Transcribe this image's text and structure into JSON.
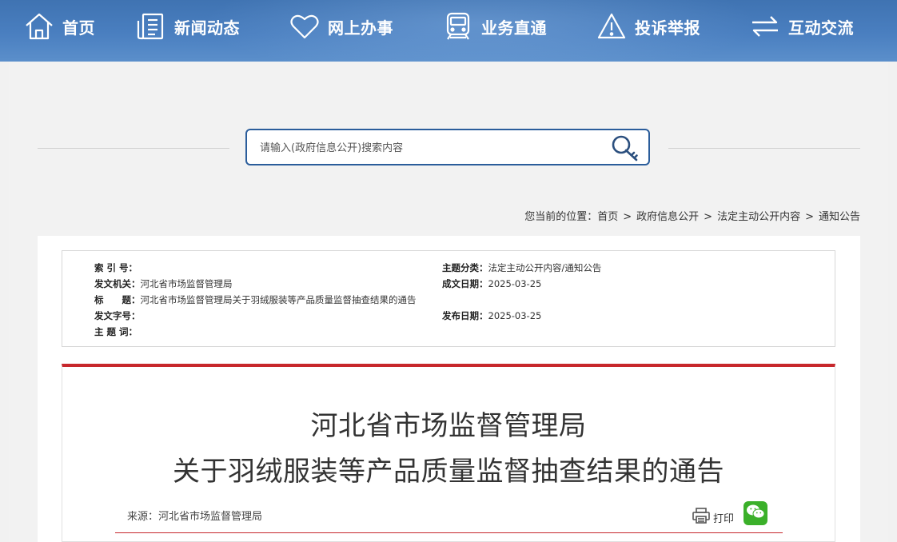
{
  "nav": {
    "items": [
      {
        "label": "首页",
        "icon": "home-icon"
      },
      {
        "label": "新闻动态",
        "icon": "news-icon"
      },
      {
        "label": "网上办事",
        "icon": "heart-icon"
      },
      {
        "label": "业务直通",
        "icon": "train-icon"
      },
      {
        "label": "投诉举报",
        "icon": "warning-icon"
      },
      {
        "label": "互动交流",
        "icon": "exchange-icon"
      }
    ]
  },
  "search": {
    "placeholder": "请输入(政府信息公开)搜索内容",
    "icon": "search-key-icon",
    "accent": "#2b5d9b"
  },
  "breadcrumb": {
    "prefix": "您当前的位置：",
    "items": [
      "首页",
      "政府信息公开",
      "法定主动公开内容",
      "通知公告"
    ],
    "separator": ">"
  },
  "meta": {
    "index_label": "索 引 号：",
    "index_value": "",
    "category_label": "主题分类：",
    "category_value": "法定主动公开内容/通知公告",
    "issuer_label": "发文机关：",
    "issuer_value": "河北省市场监督管理局",
    "written_date_label": "成文日期：",
    "written_date_value": "2025-03-25",
    "title_label": "标　　题：",
    "title_value": "河北省市场监督管理局关于羽绒服装等产品质量监督抽查结果的通告",
    "doc_no_label": "发文字号：",
    "doc_no_value": "",
    "publish_date_label": "发布日期：",
    "publish_date_value": "2025-03-25",
    "keywords_label": "主 题 词：",
    "keywords_value": ""
  },
  "article": {
    "title_line1": "河北省市场监督管理局",
    "title_line2": "关于羽绒服装等产品质量监督抽查结果的通告",
    "source": "来源：河北省市场监督管理局",
    "print_label": "打印",
    "accent": "#c7272c"
  }
}
